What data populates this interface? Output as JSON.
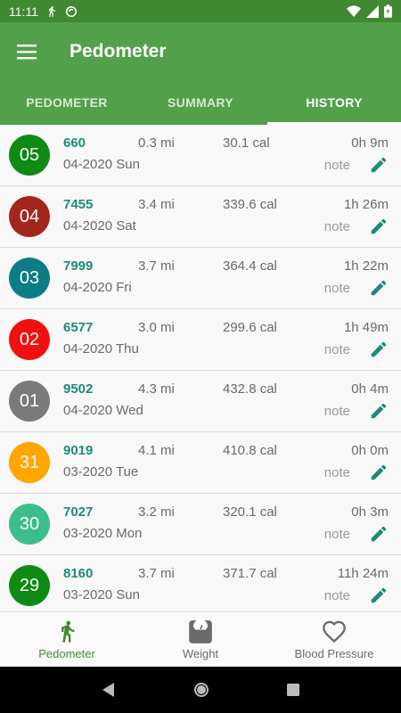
{
  "status": {
    "time": "11:11"
  },
  "appbar": {
    "title": "Pedometer"
  },
  "tabs": [
    {
      "label": "PEDOMETER"
    },
    {
      "label": "SUMMARY"
    },
    {
      "label": "HISTORY"
    }
  ],
  "history": [
    {
      "day": "05",
      "color": "#0f8a13",
      "steps": "660",
      "mi": "0.3 mi",
      "cal": "30.1 cal",
      "time": "0h 9m",
      "date": "04-2020 Sun",
      "note": "note"
    },
    {
      "day": "04",
      "color": "#a3261e",
      "steps": "7455",
      "mi": "3.4 mi",
      "cal": "339.6 cal",
      "time": "1h 26m",
      "date": "04-2020 Sat",
      "note": "note"
    },
    {
      "day": "03",
      "color": "#0c7d86",
      "steps": "7999",
      "mi": "3.7 mi",
      "cal": "364.4 cal",
      "time": "1h 22m",
      "date": "04-2020 Fri",
      "note": "note"
    },
    {
      "day": "02",
      "color": "#f01010",
      "steps": "6577",
      "mi": "3.0 mi",
      "cal": "299.6 cal",
      "time": "1h 49m",
      "date": "04-2020 Thu",
      "note": "note"
    },
    {
      "day": "01",
      "color": "#7a7a7a",
      "steps": "9502",
      "mi": "4.3 mi",
      "cal": "432.8 cal",
      "time": "0h 4m",
      "date": "04-2020 Wed",
      "note": "note"
    },
    {
      "day": "31",
      "color": "#ffa600",
      "steps": "9019",
      "mi": "4.1 mi",
      "cal": "410.8 cal",
      "time": "0h 0m",
      "date": "03-2020 Tue",
      "note": "note"
    },
    {
      "day": "30",
      "color": "#3bbd8c",
      "steps": "7027",
      "mi": "3.2 mi",
      "cal": "320.1 cal",
      "time": "0h 3m",
      "date": "03-2020 Mon",
      "note": "note"
    },
    {
      "day": "29",
      "color": "#0f8a13",
      "steps": "8160",
      "mi": "3.7 mi",
      "cal": "371.7 cal",
      "time": "11h 24m",
      "date": "03-2020 Sun",
      "note": "note"
    }
  ],
  "bottomnav": [
    {
      "label": "Pedometer",
      "icon": "walker-icon"
    },
    {
      "label": "Weight",
      "icon": "scale-icon"
    },
    {
      "label": "Blood Pressure",
      "icon": "heart-icon"
    }
  ],
  "colors": {
    "primary": "#52a04a",
    "primary_dark": "#3f8a31",
    "accent_text": "#1f8a7a"
  }
}
